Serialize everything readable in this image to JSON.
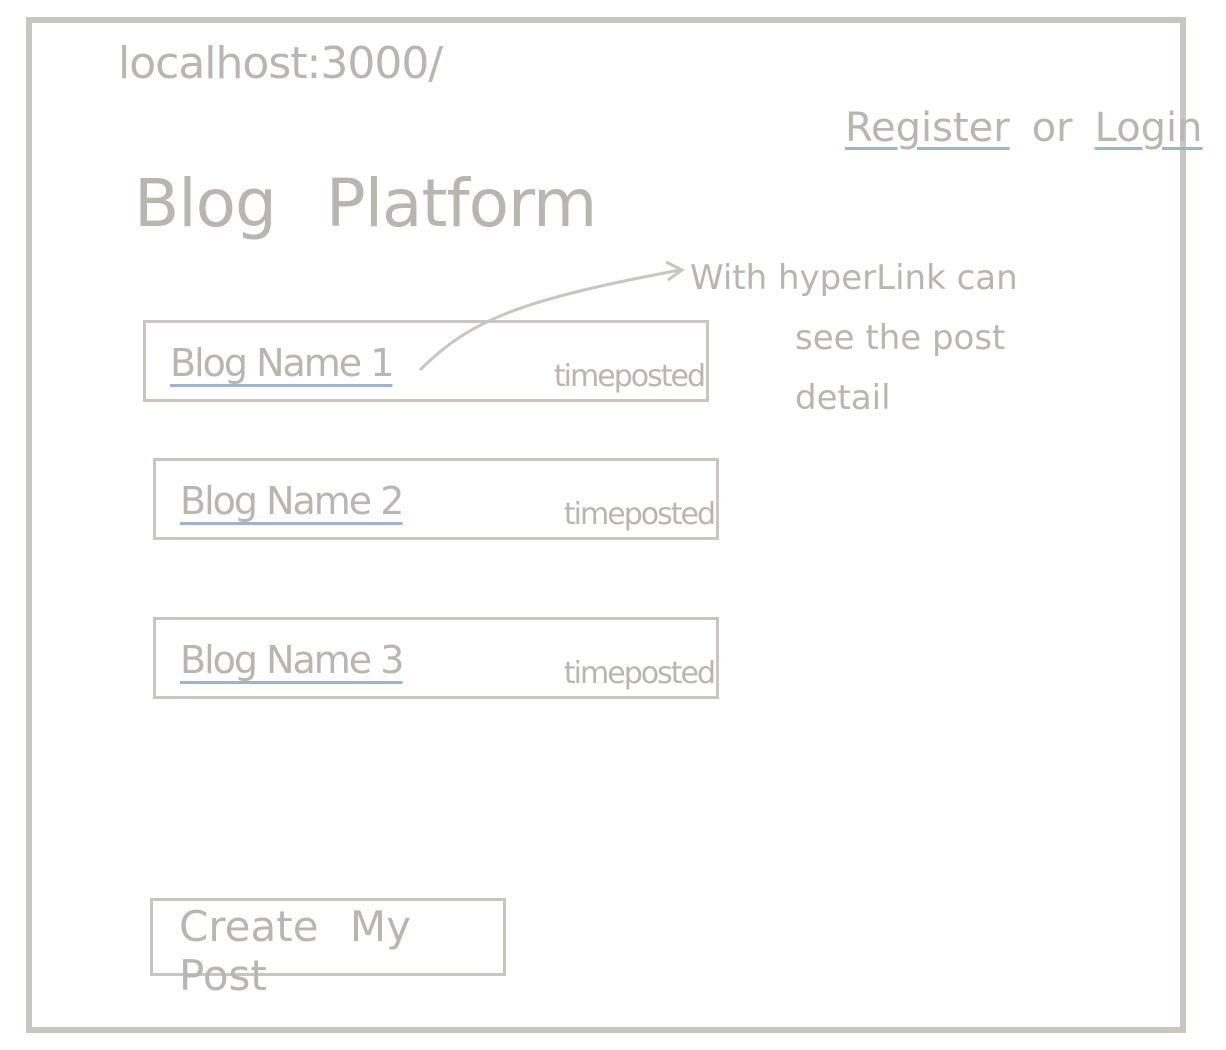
{
  "url": "localhost:3000/",
  "auth": {
    "register": "Register",
    "or": "or",
    "login": "Login"
  },
  "title": {
    "word1": "Blog",
    "word2": "Platform"
  },
  "annotation": {
    "line1": "With hyperLink can",
    "line2": "see the post detail"
  },
  "posts": [
    {
      "name": "Blog Name 1",
      "time": "timeposted"
    },
    {
      "name": "Blog Name 2",
      "time": "timeposted"
    },
    {
      "name": "Blog Name 3",
      "time": "timeposted"
    }
  ],
  "create_button": "Create My Post",
  "colors": {
    "stroke": "#c9c6c0",
    "link_underline": "#9db3d6"
  }
}
